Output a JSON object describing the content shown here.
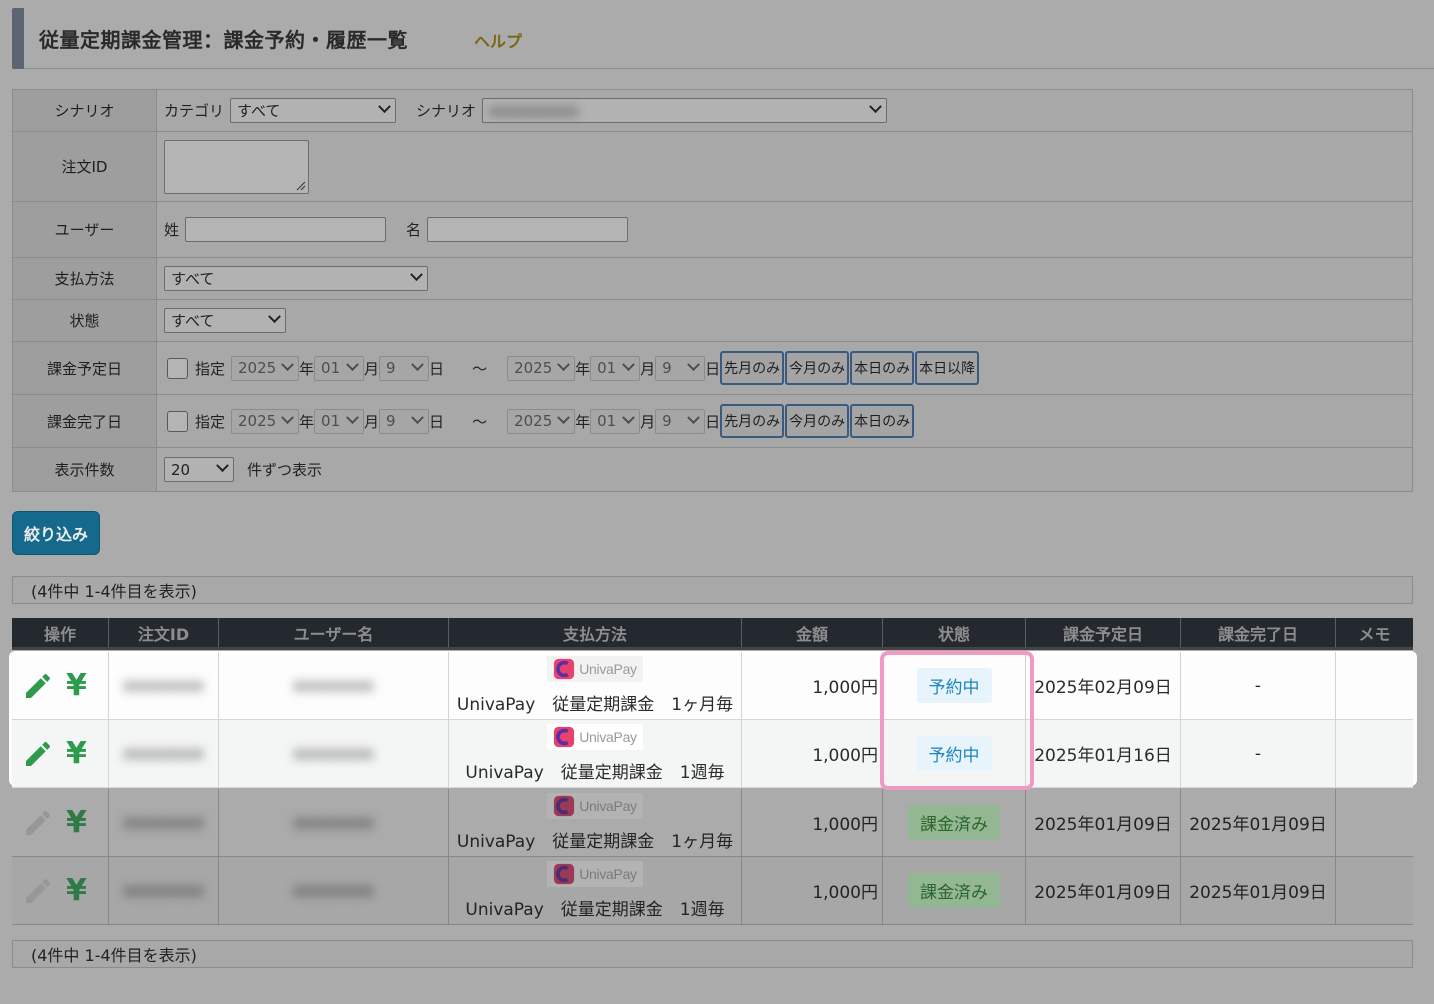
{
  "header": {
    "title": "従量定期課金管理：課金予約・履歴一覧",
    "help": "ヘルプ"
  },
  "filters": {
    "scenario_label": "シナリオ",
    "category_label": "カテゴリ",
    "category_value": "すべて",
    "scenario_select_label": "シナリオ",
    "scenario_value": "xxxxxxxxxx",
    "order_id_label": "注文ID",
    "user_label": "ユーザー",
    "last_name_label": "姓",
    "first_name_label": "名",
    "payment_label": "支払方法",
    "payment_value": "すべて",
    "status_label": "状態",
    "status_value": "すべて",
    "scheduled_label": "課金予定日",
    "completed_label": "課金完了日",
    "specify_label": "指定",
    "year_value": "2025",
    "month_value": "01",
    "day_value": "9",
    "year_unit": "年",
    "month_unit": "月",
    "day_unit": "日",
    "tilde": "～",
    "btn_last_month": "先月のみ",
    "btn_this_month": "今月のみ",
    "btn_today": "本日のみ",
    "btn_after_today": "本日以降",
    "per_page_label": "表示件数",
    "per_page_value": "20",
    "per_page_suffix": "件ずつ表示"
  },
  "filter_button": "絞り込み",
  "count_text": "(4件中 1-4件目を表示)",
  "table": {
    "headers": [
      "操作",
      "注文ID",
      "ユーザー名",
      "支払方法",
      "金額",
      "状態",
      "課金予定日",
      "課金完了日",
      "メモ"
    ],
    "rows": [
      {
        "order_id": "xxxxxxxx",
        "user": "xxxxxxxx",
        "logo": "UnivaPay",
        "payment": "UnivaPay　従量定期課金　1ヶ月毎",
        "amount": "1,000円",
        "status": "予約中",
        "scheduled": "2025年02月09日",
        "completed": "-",
        "memo": ""
      },
      {
        "order_id": "xxxxxxxx",
        "user": "xxxxxxxx",
        "logo": "UnivaPay",
        "payment": "UnivaPay　従量定期課金　1週毎",
        "amount": "1,000円",
        "status": "予約中",
        "scheduled": "2025年01月16日",
        "completed": "-",
        "memo": ""
      },
      {
        "order_id": "xxxxxxxx",
        "user": "xxxxxxxx",
        "logo": "UnivaPay",
        "payment": "UnivaPay　従量定期課金　1ヶ月毎",
        "amount": "1,000円",
        "status": "課金済み",
        "scheduled": "2025年01月09日",
        "completed": "2025年01月09日",
        "memo": ""
      },
      {
        "order_id": "xxxxxxxx",
        "user": "xxxxxxxx",
        "logo": "UnivaPay",
        "payment": "UnivaPay　従量定期課金　1週毎",
        "amount": "1,000円",
        "status": "課金済み",
        "scheduled": "2025年01月09日",
        "completed": "2025年01月09日",
        "memo": ""
      }
    ]
  },
  "colors": {
    "highlight": "#ef9ac3",
    "reserved": "#1d84bd",
    "done": "#2c642c",
    "edit_icon": "#2e9a4b"
  }
}
